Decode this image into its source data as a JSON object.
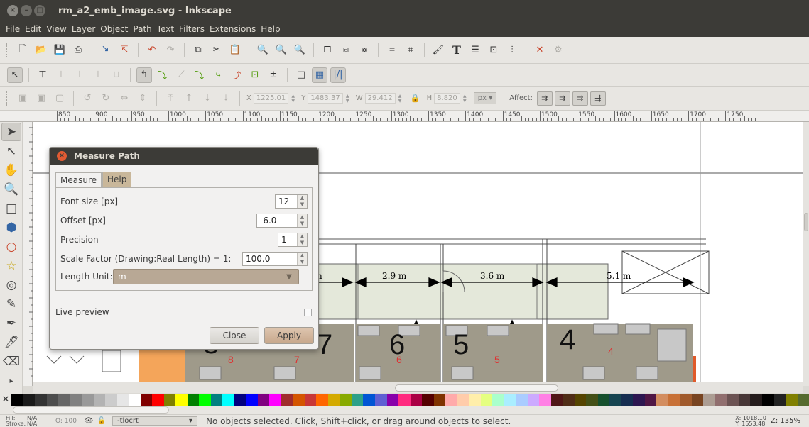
{
  "window": {
    "title": "rm_a2_emb_image.svg - Inkscape"
  },
  "menu": [
    "File",
    "Edit",
    "View",
    "Layer",
    "Object",
    "Path",
    "Text",
    "Filters",
    "Extensions",
    "Help"
  ],
  "controls": {
    "x_label": "X",
    "x_value": "1225.01",
    "y_label": "Y",
    "y_value": "1483.37",
    "w_label": "W",
    "w_value": "29.412",
    "h_label": "H",
    "h_value": "8.820",
    "unit": "px",
    "affect_label": "Affect:"
  },
  "ruler": {
    "labels": [
      "850",
      "900",
      "950",
      "1000",
      "1050",
      "1100",
      "1150",
      "1200",
      "1250",
      "1300",
      "1350",
      "1400",
      "1450",
      "1500",
      "1550",
      "1600",
      "1650",
      "1700",
      "1750"
    ]
  },
  "dialog": {
    "title": "Measure Path",
    "tabs": [
      "Measure",
      "Help"
    ],
    "font_size_label": "Font size [px]",
    "font_size": "12",
    "offset_label": "Offset [px]",
    "offset": "-6.0",
    "precision_label": "Precision",
    "precision": "1",
    "scale_label": "Scale Factor (Drawing:Real Length) = 1:",
    "scale": "100.0",
    "unit_label": "Length Unit:",
    "unit": "m",
    "live_preview_label": "Live preview",
    "close_label": "Close",
    "apply_label": "Apply"
  },
  "canvas": {
    "dim_labels": [
      "n",
      "2.9 m",
      "3.6 m",
      "5.1 m"
    ],
    "room_big": [
      "7",
      "6",
      "5",
      "4"
    ],
    "room_red": [
      "8",
      "7",
      "6",
      "5",
      "4"
    ]
  },
  "palette": [
    "#000000",
    "#1a1a1a",
    "#333333",
    "#4d4d4d",
    "#666666",
    "#808080",
    "#999999",
    "#b3b3b3",
    "#cccccc",
    "#e6e6e6",
    "#ffffff",
    "#800000",
    "#ff0000",
    "#808000",
    "#ffff00",
    "#008000",
    "#00ff00",
    "#008080",
    "#00ffff",
    "#000080",
    "#0000ff",
    "#800080",
    "#ff00ff",
    "#a02c2c",
    "#d45500",
    "#c83737",
    "#ff6600",
    "#d4aa00",
    "#88aa00",
    "#2ca089",
    "#0055d4",
    "#5f5fd3",
    "#8800aa",
    "#ff2a7f",
    "#aa0044",
    "#550000",
    "#803300",
    "#ffaaaa",
    "#ffccaa",
    "#ffeeaa",
    "#e5ff80",
    "#aaffcc",
    "#aaeeff",
    "#aaccff",
    "#ccaaff",
    "#ff80e5",
    "#501616",
    "#502d16",
    "#554400",
    "#445016",
    "#16502d",
    "#164450",
    "#162d50",
    "#2d1650",
    "#501644",
    "#d38d5f",
    "#c87137",
    "#a05a2c",
    "#784421",
    "#ac9d93",
    "#916f6f",
    "#6c5353",
    "#483737",
    "#241c1c",
    "#000000",
    "#222222",
    "#808000",
    "#556b2f"
  ],
  "status": {
    "fill_label": "Fill:",
    "fill_value": "N/A",
    "stroke_label": "Stroke:",
    "stroke_value": "N/A",
    "opacity": "O: 100",
    "layer": "-tlocrt",
    "message": "No objects selected. Click, Shift+click, or drag around objects to select.",
    "x": "X: 1018.10",
    "y": "Y: 1553.48",
    "zoom": "Z: 135%"
  },
  "icons": {
    "new": "new-document-icon",
    "open": "open-icon",
    "save": "save-icon",
    "print": "print-icon",
    "import": "import-icon",
    "export": "export-icon",
    "undo": "undo-icon",
    "redo": "redo-icon",
    "copy": "copy-icon",
    "cut": "cut-icon",
    "paste": "paste-icon",
    "zoom_sel": "zoom-selection-icon",
    "zoom_drawing": "zoom-drawing-icon",
    "zoom_page": "zoom-page-icon",
    "duplicate": "duplicate-icon",
    "clone": "clone-icon",
    "unlink": "unlink-clone-icon",
    "group": "group-icon",
    "ungroup": "ungroup-icon",
    "fill_stroke": "fill-stroke-icon",
    "text_font": "text-font-icon",
    "layers": "layers-icon",
    "xml": "xml-editor-icon",
    "align": "align-icon",
    "prefs": "preferences-icon",
    "docprops": "document-properties-icon"
  }
}
